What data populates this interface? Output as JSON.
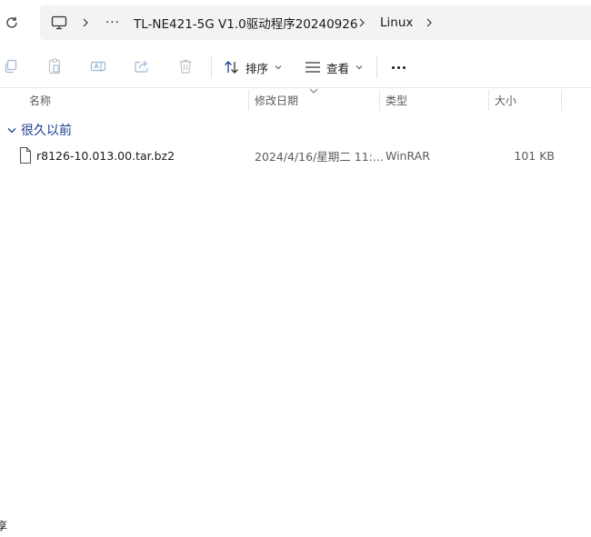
{
  "address": {
    "overflow": "···",
    "crumbs": [
      "TL-NE421-5G V1.0驱动程序20240926",
      "Linux"
    ]
  },
  "toolbar": {
    "sort_label": "排序",
    "view_label": "查看"
  },
  "columns": {
    "name": "名称",
    "modified": "修改日期",
    "type": "类型",
    "size": "大小"
  },
  "group": {
    "label": "很久以前"
  },
  "files": [
    {
      "name": "r8126-10.013.00.tar.bz2",
      "modified": "2024/4/16/星期二 11:...",
      "type": "WinRAR",
      "size": "101 KB"
    }
  ],
  "status_fragment": "享"
}
